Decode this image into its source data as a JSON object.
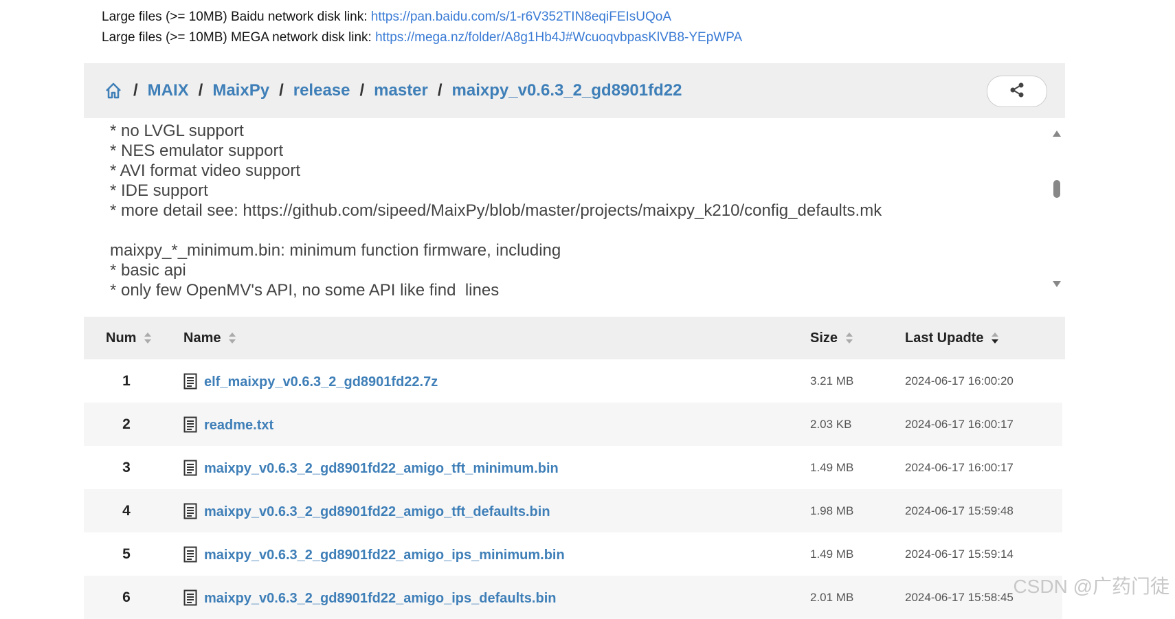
{
  "links": [
    {
      "prefix": "Large files (>= 10MB) Baidu network disk link: ",
      "url": "https://pan.baidu.com/s/1-r6V352TIN8eqiFEIsUQoA"
    },
    {
      "prefix": "Large files (>= 10MB) MEGA network disk link: ",
      "url": "https://mega.nz/folder/A8g1Hb4J#WcuoqvbpasKlVB8-YEpWPA"
    }
  ],
  "breadcrumb": {
    "items": [
      "MAIX",
      "MaixPy",
      "release",
      "master",
      "maixpy_v0.6.3_2_gd8901fd22"
    ],
    "separator": "/"
  },
  "readme": {
    "text": "* no LVGL support\n* NES emulator support\n* AVI format video support\n* IDE support\n* more detail see: https://github.com/sipeed/MaixPy/blob/master/projects/maixpy_k210/config_defaults.mk\n\nmaixpy_*_minimum.bin: minimum function firmware, including\n* basic api\n* only few OpenMV's API, no some API like find  lines"
  },
  "table": {
    "headers": {
      "num": "Num",
      "name": "Name",
      "size": "Size",
      "date": "Last Upadte"
    },
    "rows": [
      {
        "num": "1",
        "name": "elf_maixpy_v0.6.3_2_gd8901fd22.7z",
        "size": "3.21 MB",
        "date": "2024-06-17 16:00:20"
      },
      {
        "num": "2",
        "name": "readme.txt",
        "size": "2.03 KB",
        "date": "2024-06-17 16:00:17"
      },
      {
        "num": "3",
        "name": "maixpy_v0.6.3_2_gd8901fd22_amigo_tft_minimum.bin",
        "size": "1.49 MB",
        "date": "2024-06-17 16:00:17"
      },
      {
        "num": "4",
        "name": "maixpy_v0.6.3_2_gd8901fd22_amigo_tft_defaults.bin",
        "size": "1.98 MB",
        "date": "2024-06-17 15:59:48"
      },
      {
        "num": "5",
        "name": "maixpy_v0.6.3_2_gd8901fd22_amigo_ips_minimum.bin",
        "size": "1.49 MB",
        "date": "2024-06-17 15:59:14"
      },
      {
        "num": "6",
        "name": "maixpy_v0.6.3_2_gd8901fd22_amigo_ips_defaults.bin",
        "size": "2.01 MB",
        "date": "2024-06-17 15:58:45"
      }
    ]
  },
  "watermark": "CSDN @广药门徒",
  "colors": {
    "link": "#3a7bd5",
    "crumb_link": "#3f7fb8",
    "header_bg": "#efefef"
  }
}
